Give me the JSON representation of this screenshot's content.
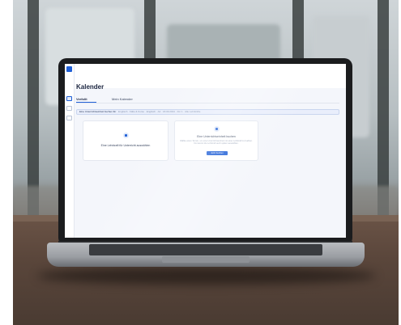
{
  "app": {
    "title": "Kalender",
    "tabs": [
      {
        "label": "Verfolit",
        "active": true
      },
      {
        "label": "Mein Kalender",
        "active": false
      }
    ],
    "filter": {
      "label": "Eine Unterrichtseinheit buchen für",
      "values": "Englisch · Fälle & Kurse · Englisch · A2 · 18.09.2024 · Für 1 · Alle Lehrkräfte"
    },
    "cards": [
      {
        "text": "Eine Lehrkraft für Unterricht auswählen"
      },
      {
        "text": "Eine Unterrichtseinheit buchen",
        "sub": "Wähle einen Termin, um eine Unterrichtseinheit mit einer Lehrkraft zu buchen. Du kannst die Lehrkraft auch später auswählen.",
        "button": "Jetzt buchen"
      }
    ]
  },
  "colors": {
    "accent": "#1f5fd6",
    "screen_bg": "#f4f6fb",
    "laptop_bezel": "#1b1c1e"
  }
}
